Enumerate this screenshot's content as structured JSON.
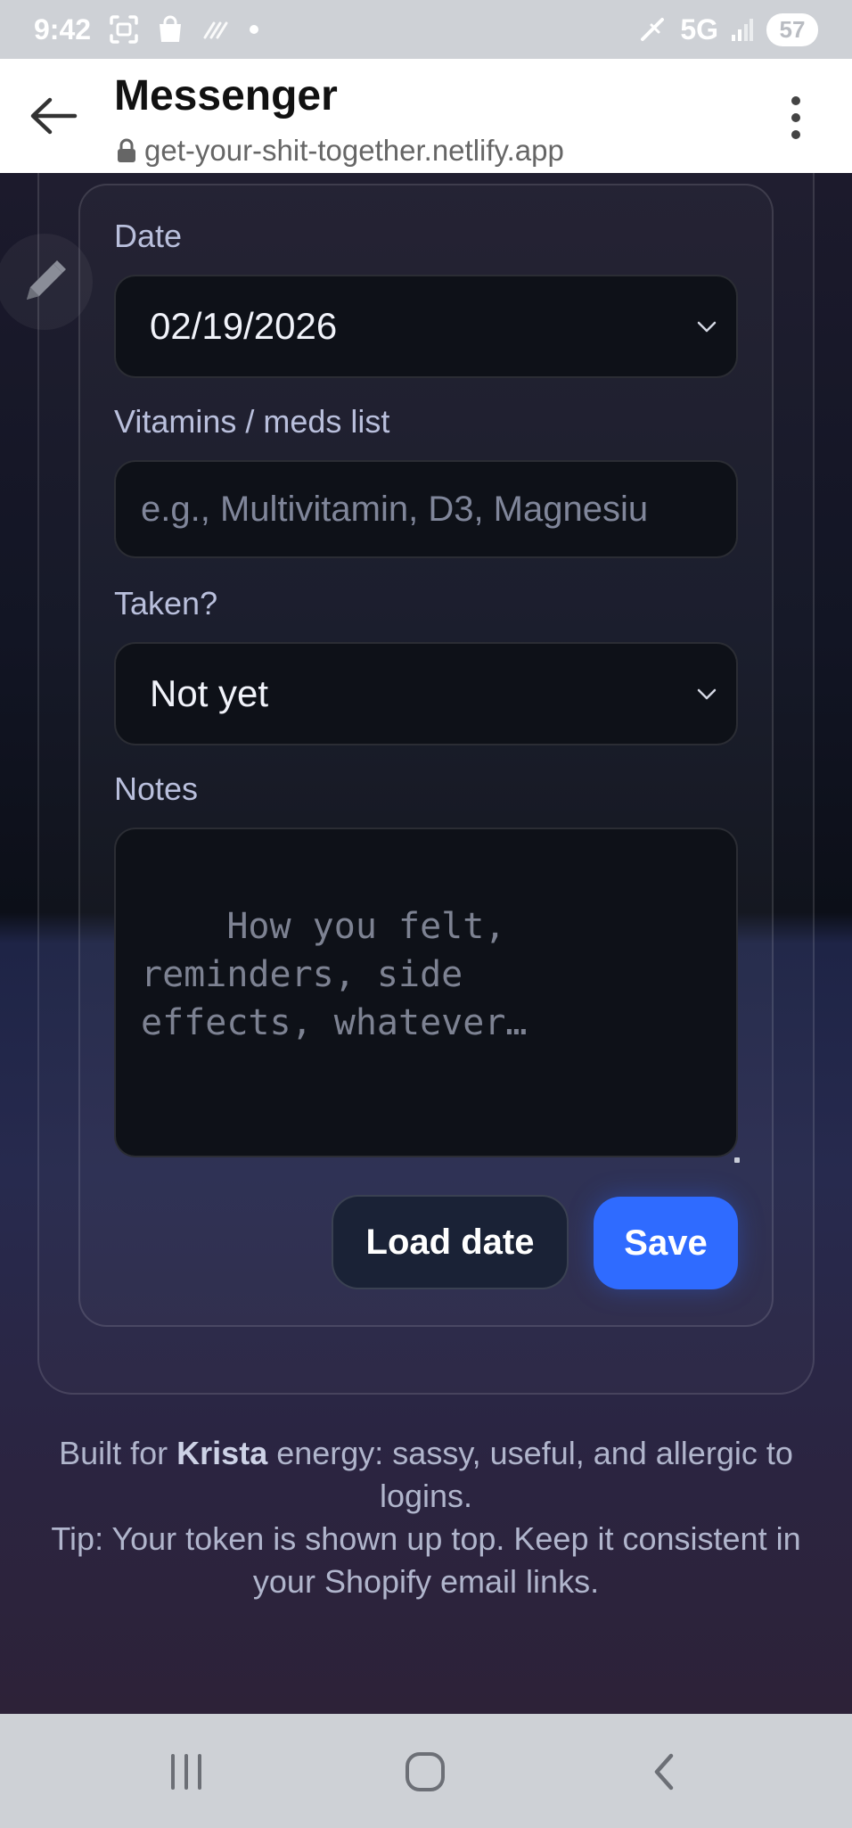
{
  "status_bar": {
    "time": "9:42",
    "network": "5G",
    "battery": "57"
  },
  "header": {
    "title": "Messenger",
    "url": "get-your-shit-together.netlify.app"
  },
  "form": {
    "date_label": "Date",
    "date_value": "02/19/2026",
    "meds_label": "Vitamins / meds list",
    "meds_placeholder": "e.g., Multivitamin, D3, Magnesiu",
    "taken_label": "Taken?",
    "taken_value": "Not yet",
    "notes_label": "Notes",
    "notes_placeholder": "How you felt,\nreminders, side\neffects, whatever…",
    "load_button": "Load date",
    "save_button": "Save"
  },
  "footer": {
    "line1_prefix": "Built for ",
    "line1_name": "Krista",
    "line1_suffix": " energy: sassy, useful, and allergic to logins.",
    "line2": "Tip: Your token is shown up top. Keep it consistent in your Shopify email links."
  },
  "colors": {
    "accent": "#2f6bff",
    "field_bg": "#0e1118",
    "label": "#b9bfdc"
  }
}
